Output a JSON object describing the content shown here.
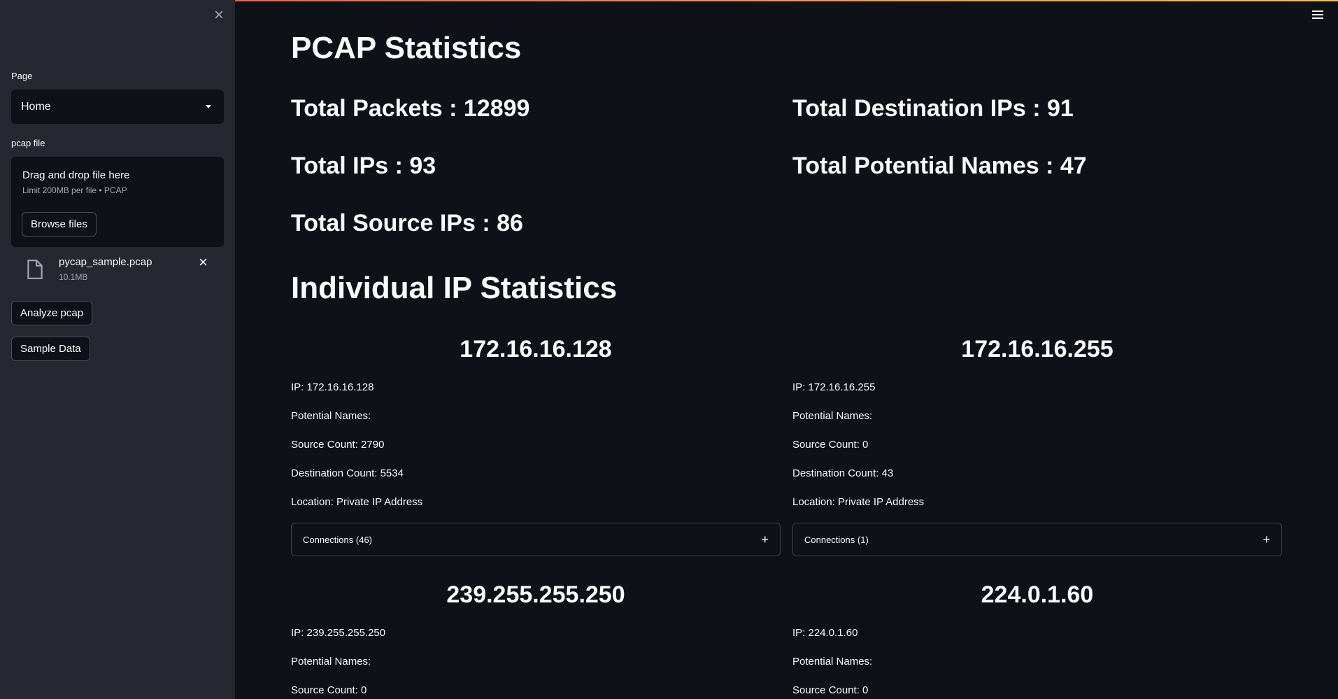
{
  "sidebar": {
    "page_label": "Page",
    "page_select_value": "Home",
    "pcap_label": "pcap file",
    "dropzone_title": "Drag and drop file here",
    "dropzone_limit": "Limit 200MB per file • PCAP",
    "browse_label": "Browse files",
    "file_name": "pycap_sample.pcap",
    "file_size": "10.1MB",
    "analyze_label": "Analyze pcap",
    "sample_label": "Sample Data"
  },
  "main": {
    "title": "PCAP Statistics",
    "total_packets": "Total Packets : 12899",
    "total_ips": "Total IPs : 93",
    "total_source_ips": "Total Source IPs : 86",
    "total_destination_ips": "Total Destination IPs : 91",
    "total_potential_names": "Total Potential Names : 47",
    "individual_title": "Individual IP Statistics"
  },
  "ips": [
    {
      "title": "172.16.16.128",
      "ip": "IP: 172.16.16.128",
      "names": "Potential Names:",
      "source": "Source Count: 2790",
      "destination": "Destination Count: 5534",
      "location": "Location: Private IP Address",
      "connections": "Connections (46)"
    },
    {
      "title": "172.16.16.255",
      "ip": "IP: 172.16.16.255",
      "names": "Potential Names:",
      "source": "Source Count: 0",
      "destination": "Destination Count: 43",
      "location": "Location: Private IP Address",
      "connections": "Connections (1)"
    },
    {
      "title": "239.255.255.250",
      "ip": "IP: 239.255.255.250",
      "names": "Potential Names:",
      "source": "Source Count: 0"
    },
    {
      "title": "224.0.1.60",
      "ip": "IP: 224.0.1.60",
      "names": "Potential Names:",
      "source": "Source Count: 0"
    }
  ],
  "icons": {
    "expand": "+",
    "close": "×"
  }
}
